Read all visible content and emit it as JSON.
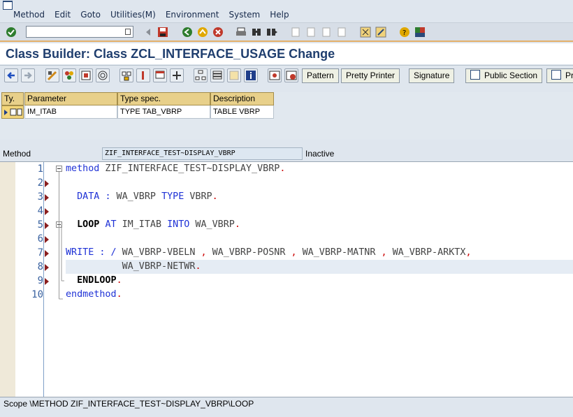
{
  "menubar": {
    "items": [
      "Method",
      "Edit",
      "Goto",
      "Utilities(M)",
      "Environment",
      "System",
      "Help"
    ]
  },
  "toolbar": {
    "command_field_value": "",
    "icons": [
      "enter-icon",
      "back-arrow-icon",
      "save-icon",
      "back-icon",
      "exit-icon",
      "cancel-icon",
      "print-icon",
      "find-icon",
      "find-next-icon",
      "first-page-icon",
      "previous-page-icon",
      "next-page-icon",
      "last-page-icon",
      "create-session-icon",
      "shortcut-icon",
      "help-icon",
      "customize-layout-icon"
    ]
  },
  "title": "Class Builder: Class ZCL_INTERFACE_USAGE Change",
  "app_toolbar": {
    "buttons": [
      "Pattern",
      "Pretty Printer",
      "Signature",
      "Public Section",
      "Pr"
    ]
  },
  "params": {
    "headers": [
      "Ty.",
      "Parameter",
      "Type spec.",
      "Description"
    ],
    "rows": [
      {
        "type": "",
        "parameter": "IM_ITAB",
        "type_spec": "TYPE TAB_VBRP",
        "description": "TABLE VBRP"
      }
    ]
  },
  "method": {
    "label": "Method",
    "name": "ZIF_INTERFACE_TEST~DISPLAY_VBRP",
    "status": "Inactive"
  },
  "editor": {
    "line_numbers": [
      "1",
      "2",
      "3",
      "4",
      "5",
      "6",
      "7",
      "8",
      "9",
      "10"
    ],
    "lines": [
      "method ZIF_INTERFACE_TEST~DISPLAY_VBRP.",
      "",
      "  DATA : WA_VBRP TYPE VBRP.",
      "",
      "  LOOP AT IM_ITAB INTO WA_VBRP.",
      "",
      "WRITE : / WA_VBRP-VBELN , WA_VBRP-POSNR , WA_VBRP-MATNR , WA_VBRP-ARKTX,",
      "          WA_VBRP-NETWR.",
      "  ENDLOOP.",
      "endmethod."
    ]
  },
  "statusbar": {
    "text": "Scope \\METHOD ZIF_INTERFACE_TEST~DISPLAY_VBRP\\LOOP"
  },
  "colors": {
    "title": "#1f3e6e",
    "keyword": "#1f32d6",
    "line_number": "#3a62a0",
    "toolbar_accent": "#e4b06a"
  }
}
